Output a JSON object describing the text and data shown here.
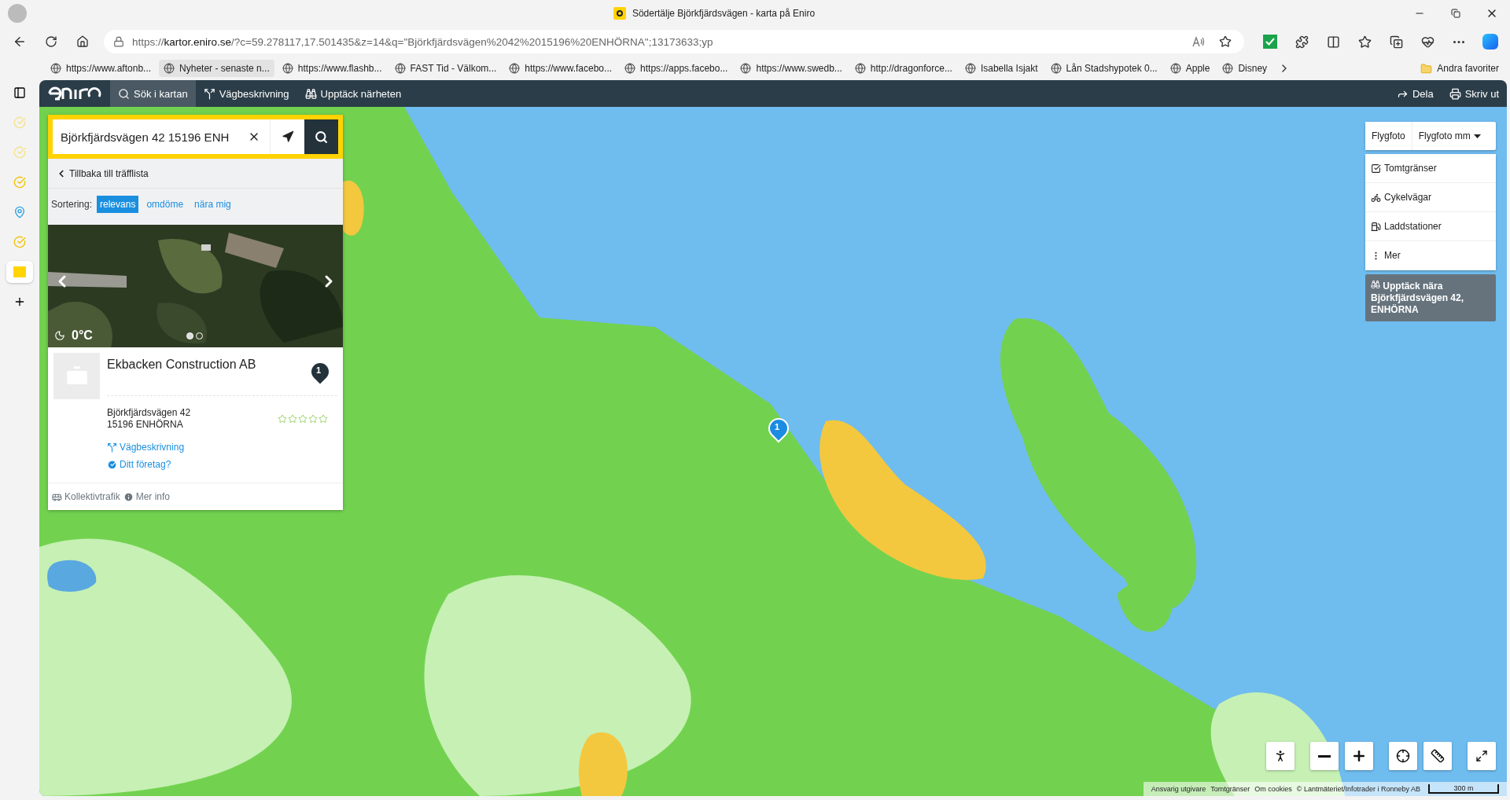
{
  "browser": {
    "tab_title": "Södertälje Björkfjärdsvägen - karta på Eniro",
    "url_scheme": "https://",
    "url_host": "kartor.eniro.se",
    "url_rest": "/?c=59.278117,17.501435&z=14&q=\"Björkfjärdsvägen%2042%2015196%20ENHÖRNA\";13173633;yp",
    "bookmarks": [
      {
        "label": "https://www.aftonb...",
        "selected": false
      },
      {
        "label": "Nyheter - senaste n...",
        "selected": true
      },
      {
        "label": "https://www.flashb...",
        "selected": false
      },
      {
        "label": "FAST Tid - Välkom...",
        "selected": false
      },
      {
        "label": "https://www.facebo...",
        "selected": false
      },
      {
        "label": "https://apps.facebo...",
        "selected": false
      },
      {
        "label": "https://www.swedb...",
        "selected": false
      },
      {
        "label": "http://dragonforce...",
        "selected": false
      },
      {
        "label": "Isabella Isjakt",
        "selected": false
      },
      {
        "label": "Lån Stadshypotek 0...",
        "selected": false
      },
      {
        "label": "Apple",
        "selected": false
      },
      {
        "label": "Disney",
        "selected": false
      }
    ],
    "other_favorites": "Andra favoriter"
  },
  "site": {
    "nav": [
      {
        "label": "Sök i kartan",
        "selected": true
      },
      {
        "label": "Vägbeskrivning",
        "selected": false
      },
      {
        "label": "Upptäck närheten",
        "selected": false
      }
    ],
    "actions": [
      "Dela",
      "Skriv ut"
    ]
  },
  "search": {
    "value": "Björkfjärdsvägen 42 15196 ENH"
  },
  "back_link": "Tillbaka till träfflista",
  "sorting": {
    "label": "Sortering:",
    "options": [
      {
        "label": "relevans",
        "selected": true
      },
      {
        "label": "omdöme",
        "selected": false
      },
      {
        "label": "nära mig",
        "selected": false
      }
    ]
  },
  "result": {
    "photo": {
      "kind": "picture",
      "temperature": "0°C",
      "dots": [
        {
          "selected": true
        },
        {
          "selected": false
        }
      ]
    },
    "name": "Ekbacken Construction AB",
    "marker": "1",
    "address": [
      "Björkfjärdsvägen 42",
      "15196 ENHÖRNA"
    ],
    "stars": 0,
    "links": [
      "Vägbeskrivning",
      "Ditt företag?"
    ],
    "footer": [
      "Kollektivtrafik",
      "Mer info"
    ]
  },
  "layers": {
    "base": [
      "Flygfoto",
      "Flygfoto mm"
    ],
    "overlays": [
      "Tomtgränser",
      "Cykelvägar",
      "Laddstationer",
      "Mer"
    ],
    "discover": "Upptäck nära Björkfjärdsvägen 42, ENHÖRNA"
  },
  "map": {
    "kind": "picture",
    "pin": "1"
  },
  "attribution": [
    "Ansvarig utgivare",
    "Tomtgränser",
    "Om cookies",
    "© Lantmäteriet/Infotrader i Ronneby AB"
  ],
  "scale": "300 m"
}
